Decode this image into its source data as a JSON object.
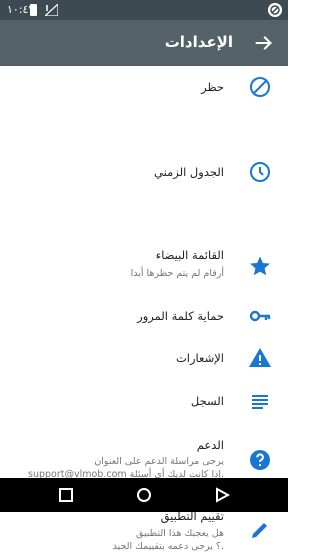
{
  "status": {
    "time": "١٠:٤٧"
  },
  "header": {
    "title": "الإعدادات"
  },
  "items": [
    {
      "label": "حظر"
    },
    {
      "label": "الجدول الزمني"
    },
    {
      "label": "القائمة البيضاء",
      "sub": "أرقام لم يتم حظرها أبدا"
    },
    {
      "label": "حماية كلمة المرور"
    },
    {
      "label": "الإشعارات"
    },
    {
      "label": "السجل"
    },
    {
      "label": "الدعم",
      "sub1": "يرجى مراسلة الدعم على العنوان",
      "sub2": "support@vlmob.com إذا كانت لديك أي أسئلة."
    },
    {
      "label": "تقييم التطبيق",
      "sub1": "هل يعجبك هذا التطبيق",
      "sub2": "؟ يرجى دعمه بتقييمك الجيد."
    }
  ],
  "colors": {
    "accent": "#1976d2",
    "appbar": "#556168",
    "statusbar": "#3e4a51"
  }
}
